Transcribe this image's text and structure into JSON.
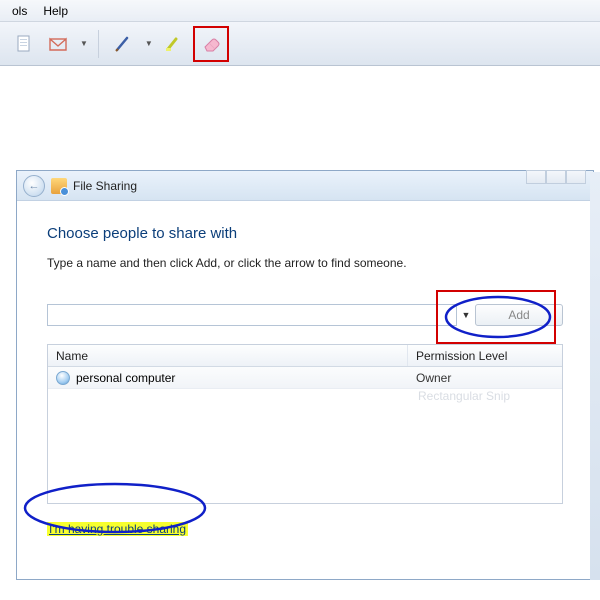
{
  "menu": {
    "items": [
      "ols",
      "Help"
    ]
  },
  "toolbar": {
    "new_icon": "new-doc",
    "highlighter_icon": "highlighter",
    "pen_icon": "pen",
    "pen2_icon": "pen-olive",
    "eraser_icon": "eraser"
  },
  "dialog": {
    "title": "File Sharing",
    "heading": "Choose people to share with",
    "subtext": "Type a name and then click Add, or click the arrow to find someone.",
    "add_label": "Add",
    "columns": {
      "name": "Name",
      "perm": "Permission Level"
    },
    "rows": [
      {
        "name": "personal computer",
        "perm": "Owner"
      }
    ],
    "watermark": "Rectangular Snip",
    "trouble_link": "I'm having trouble sharing"
  }
}
